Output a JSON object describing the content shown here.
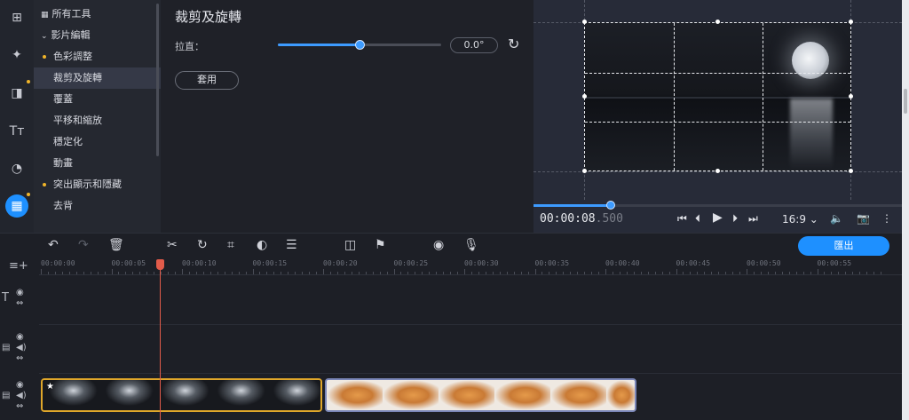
{
  "rail": {
    "items": [
      {
        "icon": "import-icon",
        "glyph": "⊞"
      },
      {
        "icon": "magic-wand-icon",
        "glyph": "✦"
      },
      {
        "icon": "transitions-icon",
        "glyph": "◨"
      },
      {
        "icon": "titles-icon",
        "glyph": "Tт"
      },
      {
        "icon": "stickers-icon",
        "glyph": "◔"
      },
      {
        "icon": "more-tools-icon",
        "glyph": "▦"
      }
    ]
  },
  "tools": {
    "all_tools": "所有工具",
    "video_editing": "影片編輯",
    "items": [
      "色彩調整",
      "裁剪及旋轉",
      "覆蓋",
      "平移和縮放",
      "穩定化",
      "動畫",
      "突出顯示和隱藏",
      "去背"
    ]
  },
  "settings": {
    "title": "裁剪及旋轉",
    "rotation_label": "拉直：",
    "rotation_value": "0.0°",
    "rotation_fraction": 0.5,
    "apply_label": "套用"
  },
  "preview": {
    "timecode_main": "00:00:08",
    "timecode_ms": ".500",
    "progress_fraction": 0.21,
    "aspect_ratio": "16:9 ⌄"
  },
  "toolbar": {
    "export_label": "匯出"
  },
  "timeline": {
    "ticks": [
      "00:00:00",
      "00:00:05",
      "00:00:10",
      "00:00:15",
      "00:00:20",
      "00:00:25",
      "00:00:30",
      "00:00:35",
      "00:00:40",
      "00:00:45",
      "00:00:50",
      "00:00:55"
    ]
  },
  "colors": {
    "accent": "#1e90ff",
    "highlight": "#f0b429",
    "playhead": "#e25b4a"
  }
}
